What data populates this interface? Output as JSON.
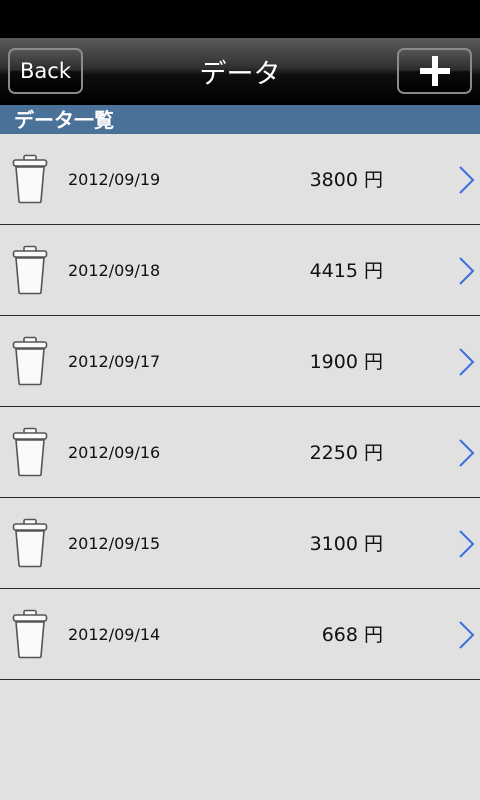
{
  "header": {
    "back_label": "Back",
    "title": "データ",
    "add_icon": "plus-icon"
  },
  "section": {
    "title": "データ一覧"
  },
  "rows": [
    {
      "date": "2012/09/19",
      "amount": "3800 円"
    },
    {
      "date": "2012/09/18",
      "amount": "4415 円"
    },
    {
      "date": "2012/09/17",
      "amount": "1900 円"
    },
    {
      "date": "2012/09/16",
      "amount": "2250 円"
    },
    {
      "date": "2012/09/15",
      "amount": "3100 円"
    },
    {
      "date": "2012/09/14",
      "amount": "668 円"
    }
  ],
  "colors": {
    "section_bg": "#4a7197",
    "chevron": "#3a6fe0",
    "list_bg": "#e1e1e1"
  }
}
